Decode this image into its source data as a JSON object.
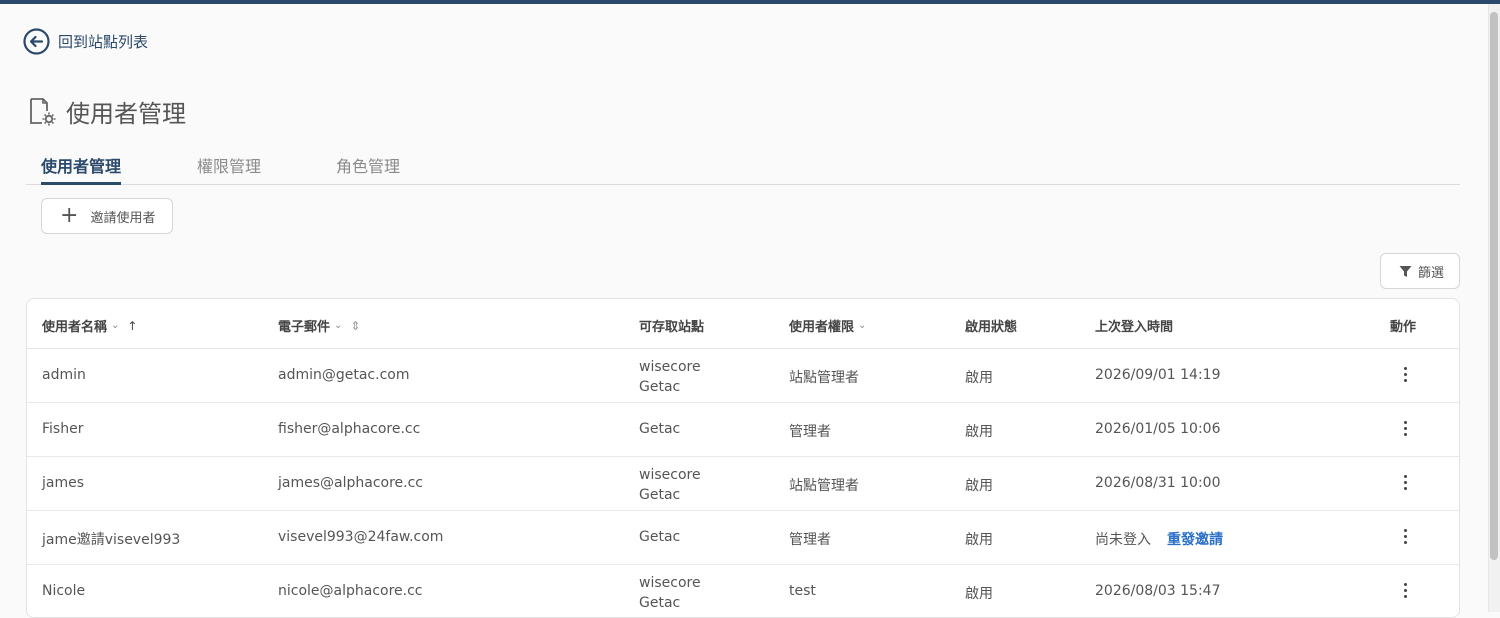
{
  "nav": {
    "back_label": "回到站點列表"
  },
  "page": {
    "title": "使用者管理"
  },
  "tabs": [
    {
      "label": "使用者管理",
      "active": true
    },
    {
      "label": "權限管理",
      "active": false
    },
    {
      "label": "角色管理",
      "active": false
    }
  ],
  "toolbar": {
    "invite_label": "邀請使用者",
    "filter_label": "篩選"
  },
  "table": {
    "columns": [
      "使用者名稱",
      "電子郵件",
      "可存取站點",
      "使用者權限",
      "啟用狀態",
      "上次登入時間",
      "動作"
    ],
    "rows": [
      {
        "name": "admin",
        "email": "admin@getac.com",
        "sites": [
          "wisecore",
          "Getac"
        ],
        "role": "站點管理者",
        "status": "啟用",
        "last_login": "2026/09/01 14:19"
      },
      {
        "name": "Fisher",
        "email": "fisher@alphacore.cc",
        "sites": [
          "Getac"
        ],
        "role": "管理者",
        "status": "啟用",
        "last_login": "2026/01/05 10:06"
      },
      {
        "name": "james",
        "email": "james@alphacore.cc",
        "sites": [
          "wisecore",
          "Getac"
        ],
        "role": "站點管理者",
        "status": "啟用",
        "last_login": "2026/08/31 10:00"
      },
      {
        "name": "jame邀請visevel993",
        "email": "visevel993@24faw.com",
        "sites": [
          "Getac"
        ],
        "role": "管理者",
        "status": "啟用",
        "last_login": "尚未登入",
        "resend": "重發邀請"
      },
      {
        "name": "Nicole",
        "email": "nicole@alphacore.cc",
        "sites": [
          "wisecore",
          "Getac"
        ],
        "role": "test",
        "status": "啟用",
        "last_login": "2026/08/03 15:47"
      }
    ]
  },
  "icons": {
    "back": "arrow-left-circle-icon",
    "title": "user-gear-document-icon",
    "add": "plus-icon",
    "filter": "funnel-icon",
    "sort_asc": "arrow-up-icon",
    "sort_both": "sort-updown-icon",
    "chevron": "chevron-down-icon",
    "more": "kebab-vertical-icon"
  },
  "colors": {
    "primary": "#2b4a6b",
    "link": "#2a6fc9"
  }
}
